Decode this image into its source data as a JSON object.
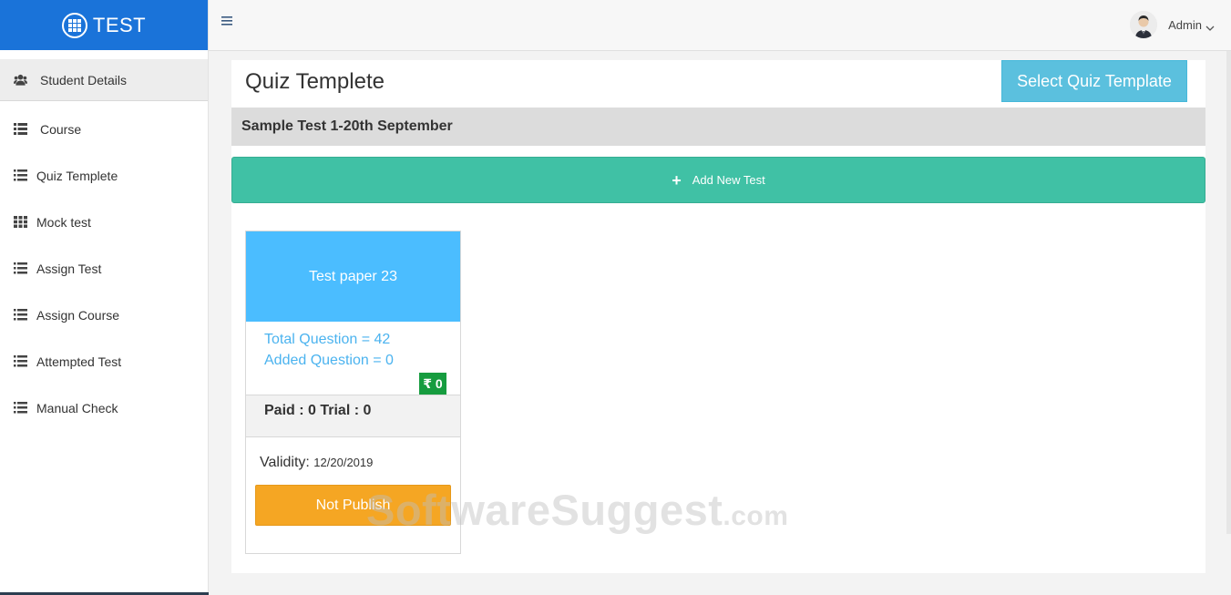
{
  "brand": {
    "title": "TEST",
    "icon": "grid-circle-icon",
    "color": "#1a73d9"
  },
  "sidebar": {
    "items": [
      {
        "label": "Student Details",
        "icon": "users-icon",
        "active": true
      },
      {
        "label": "Course",
        "icon": "list-icon"
      },
      {
        "label": "Quiz Templete",
        "icon": "list-icon"
      },
      {
        "label": "Mock test",
        "icon": "grid-icon"
      },
      {
        "label": "Assign Test",
        "icon": "list-icon"
      },
      {
        "label": "Assign Course",
        "icon": "list-icon"
      },
      {
        "label": "Attempted Test",
        "icon": "list-icon"
      },
      {
        "label": "Manual Check",
        "icon": "list-icon"
      }
    ]
  },
  "topbar": {
    "menu_icon": "hamburger-icon",
    "user_name": "Admin",
    "avatar_icon": "user-avatar-icon",
    "dropdown_icon": "chevron-down-icon"
  },
  "main": {
    "title": "Quiz Templete",
    "select_button": "Select Quiz Template",
    "section_title": "Sample Test 1-20th September",
    "add_button": "Add New Test",
    "add_icon": "plus-icon"
  },
  "card": {
    "title": "Test paper 23",
    "total_question": "Total Question = 42",
    "added_question": "Added Question = 0",
    "price": "₹ 0",
    "paid_trial": "Paid : 0 Trial : 0",
    "validity_label": "Validity:",
    "validity_date": "12/20/2019",
    "publish_button": "Not Publish"
  },
  "watermark": {
    "text": "SoftwareSuggest",
    "suffix": ".com"
  },
  "colors": {
    "accent": "#5bc0de",
    "add": "#40c1a5",
    "card_head": "#4bbdff",
    "publish": "#f5a623",
    "price": "#169c3f"
  }
}
